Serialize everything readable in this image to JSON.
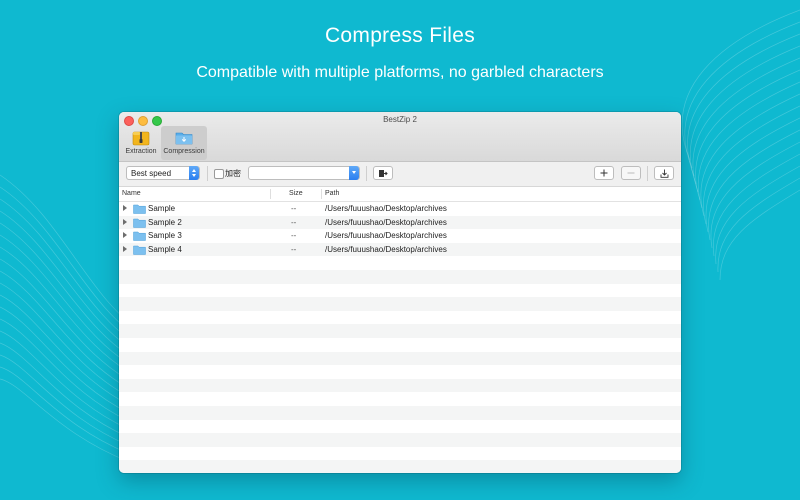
{
  "hero": {
    "title": "Compress Files",
    "subtitle": "Compatible with multiple platforms, no garbled characters"
  },
  "window": {
    "title": "BestZip 2",
    "toolbar": [
      {
        "label": "Extraction",
        "icon": "zip-archive-icon"
      },
      {
        "label": "Compression",
        "icon": "compress-folder-icon",
        "selected": true
      }
    ]
  },
  "options": {
    "speed": "Best speed",
    "encrypt_label": "加密",
    "encrypt_checked": false,
    "password": ""
  },
  "table": {
    "columns": [
      "Name",
      "Size",
      "Path"
    ],
    "rows": [
      {
        "name": "Sample",
        "size": "--",
        "path": "/Users/fuuushao/Desktop/archives"
      },
      {
        "name": "Sample 2",
        "size": "--",
        "path": "/Users/fuuushao/Desktop/archives"
      },
      {
        "name": "Sample 3",
        "size": "--",
        "path": "/Users/fuuushao/Desktop/archives"
      },
      {
        "name": "Sample 4",
        "size": "--",
        "path": "/Users/fuuushao/Desktop/archives"
      }
    ]
  },
  "colors": {
    "background": "#0fb9d0",
    "accent": "#2a7ef0",
    "folder": "#7cc0ef"
  }
}
